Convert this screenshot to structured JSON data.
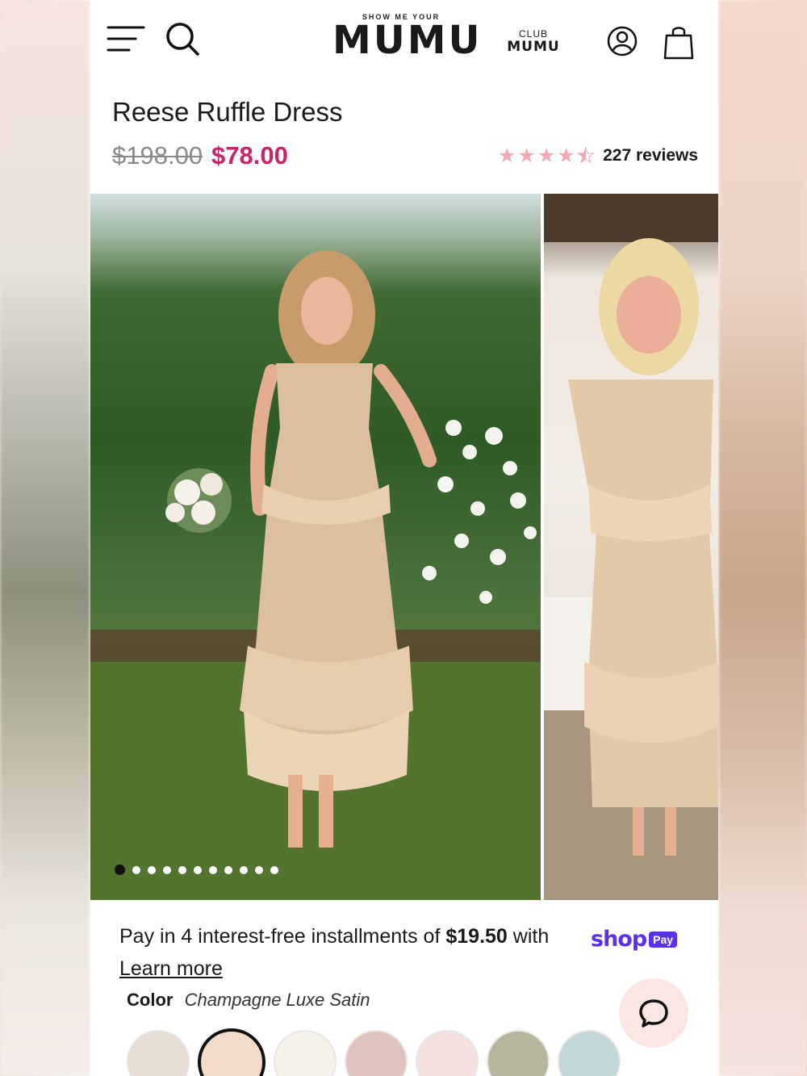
{
  "header": {
    "logo_top": "SHOW ME YOUR",
    "logo_main": "MUMU",
    "club_top": "CLUB",
    "club_main": "MUMU"
  },
  "product": {
    "title": "Reese Ruffle Dress",
    "price_original": "$198.00",
    "price_sale": "$78.00",
    "rating": 4.5,
    "reviews_label": "227 reviews"
  },
  "gallery": {
    "image_count": 11,
    "active_index": 0
  },
  "payment": {
    "text_before": "Pay in 4 interest-free installments of ",
    "amount": "$19.50",
    "text_after": " with",
    "shop_word": "shop",
    "pay_badge": "Pay",
    "learn_more": "Learn more"
  },
  "color": {
    "label": "Color",
    "value": "Champagne Luxe Satin",
    "swatches": [
      "#e7ddd2",
      "#f1dccb",
      "#f6f2ea",
      "#dfc4bd",
      "#f6e1e1",
      "#b8b59f",
      "#c3d6d8"
    ],
    "selected_index": 1
  },
  "colors": {
    "sale_price": "#c9236a",
    "shop_pay": "#5a31f4",
    "star": "#f3a9b4",
    "chat_bg": "#fbe6e4"
  },
  "icons": [
    "menu-icon",
    "search-icon",
    "account-icon",
    "bag-icon",
    "star-icon",
    "chat-icon"
  ]
}
